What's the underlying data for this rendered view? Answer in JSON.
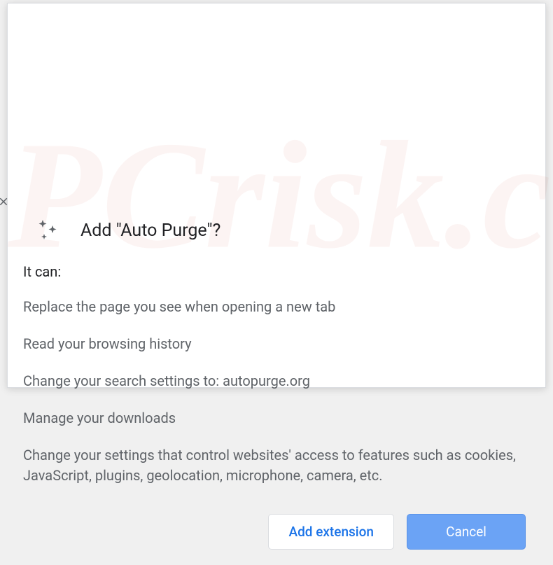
{
  "dialog": {
    "title": "Add \"Auto Purge\"?",
    "it_can_label": "It can:",
    "permissions": [
      "Replace the page you see when opening a new tab",
      "Read your browsing history",
      "Change your search settings to: autopurge.org",
      "Manage your downloads",
      "Change your settings that control websites' access to features such as cookies, JavaScript, plugins, geolocation, microphone, camera, etc."
    ],
    "buttons": {
      "add": "Add extension",
      "cancel": "Cancel"
    }
  }
}
